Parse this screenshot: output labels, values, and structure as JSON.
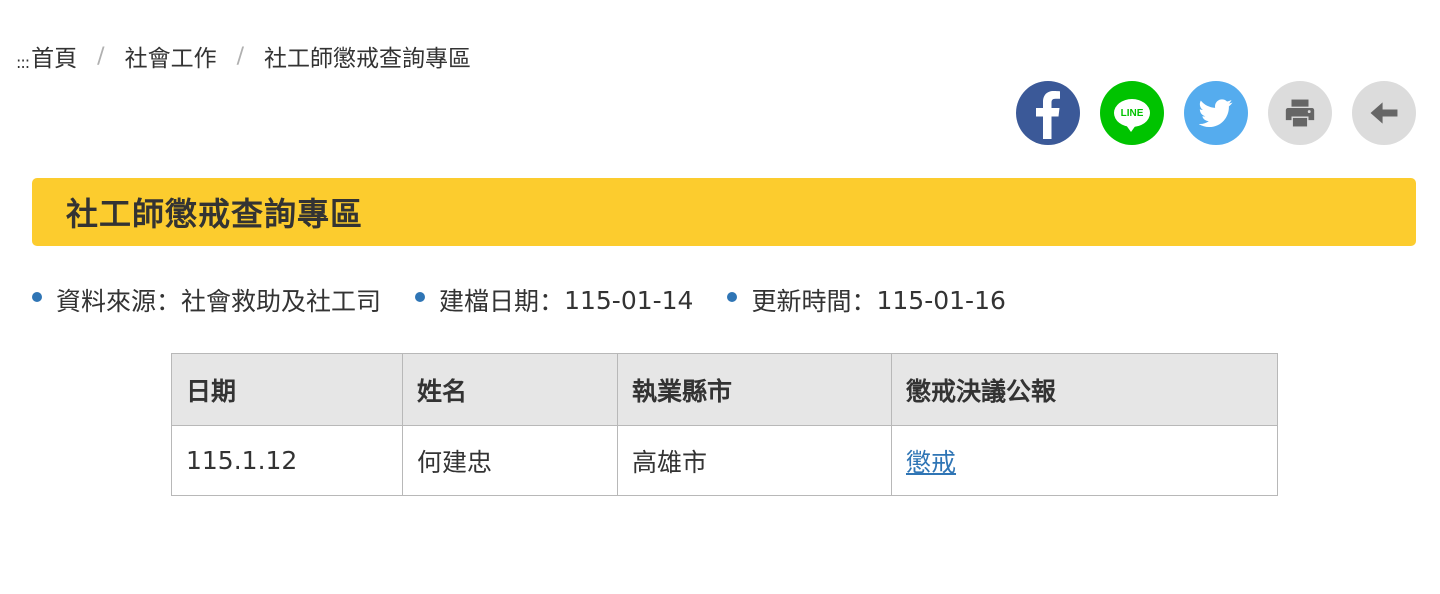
{
  "breadcrumb": {
    "dots": ":::",
    "items": [
      "首頁",
      "社會工作",
      "社工師懲戒查詢專區"
    ],
    "separator": "/"
  },
  "share": {
    "facebook": {
      "icon": "facebook-icon",
      "color": "#3b5998"
    },
    "line": {
      "icon": "line-icon",
      "label": "LINE",
      "color": "#00c300"
    },
    "twitter": {
      "icon": "twitter-icon",
      "color": "#55acee"
    },
    "print": {
      "icon": "print-icon",
      "color": "#dcdcdc"
    },
    "back": {
      "icon": "arrow-left-icon",
      "color": "#dcdcdc"
    }
  },
  "title": "社工師懲戒查詢專區",
  "title_bar_color": "#fccc2e",
  "meta": [
    {
      "label": "資料來源",
      "value": "社會救助及社工司"
    },
    {
      "label": "建檔日期",
      "value": "115-01-14"
    },
    {
      "label": "更新時間",
      "value": "115-01-16"
    }
  ],
  "meta_colon": "：",
  "accent_color": "#2f75b5",
  "table": {
    "headers": [
      "日期",
      "姓名",
      "執業縣市",
      "懲戒決議公報"
    ],
    "rows": [
      [
        "115.1.12",
        "何建忠",
        "高雄市",
        "懲戒"
      ]
    ]
  }
}
